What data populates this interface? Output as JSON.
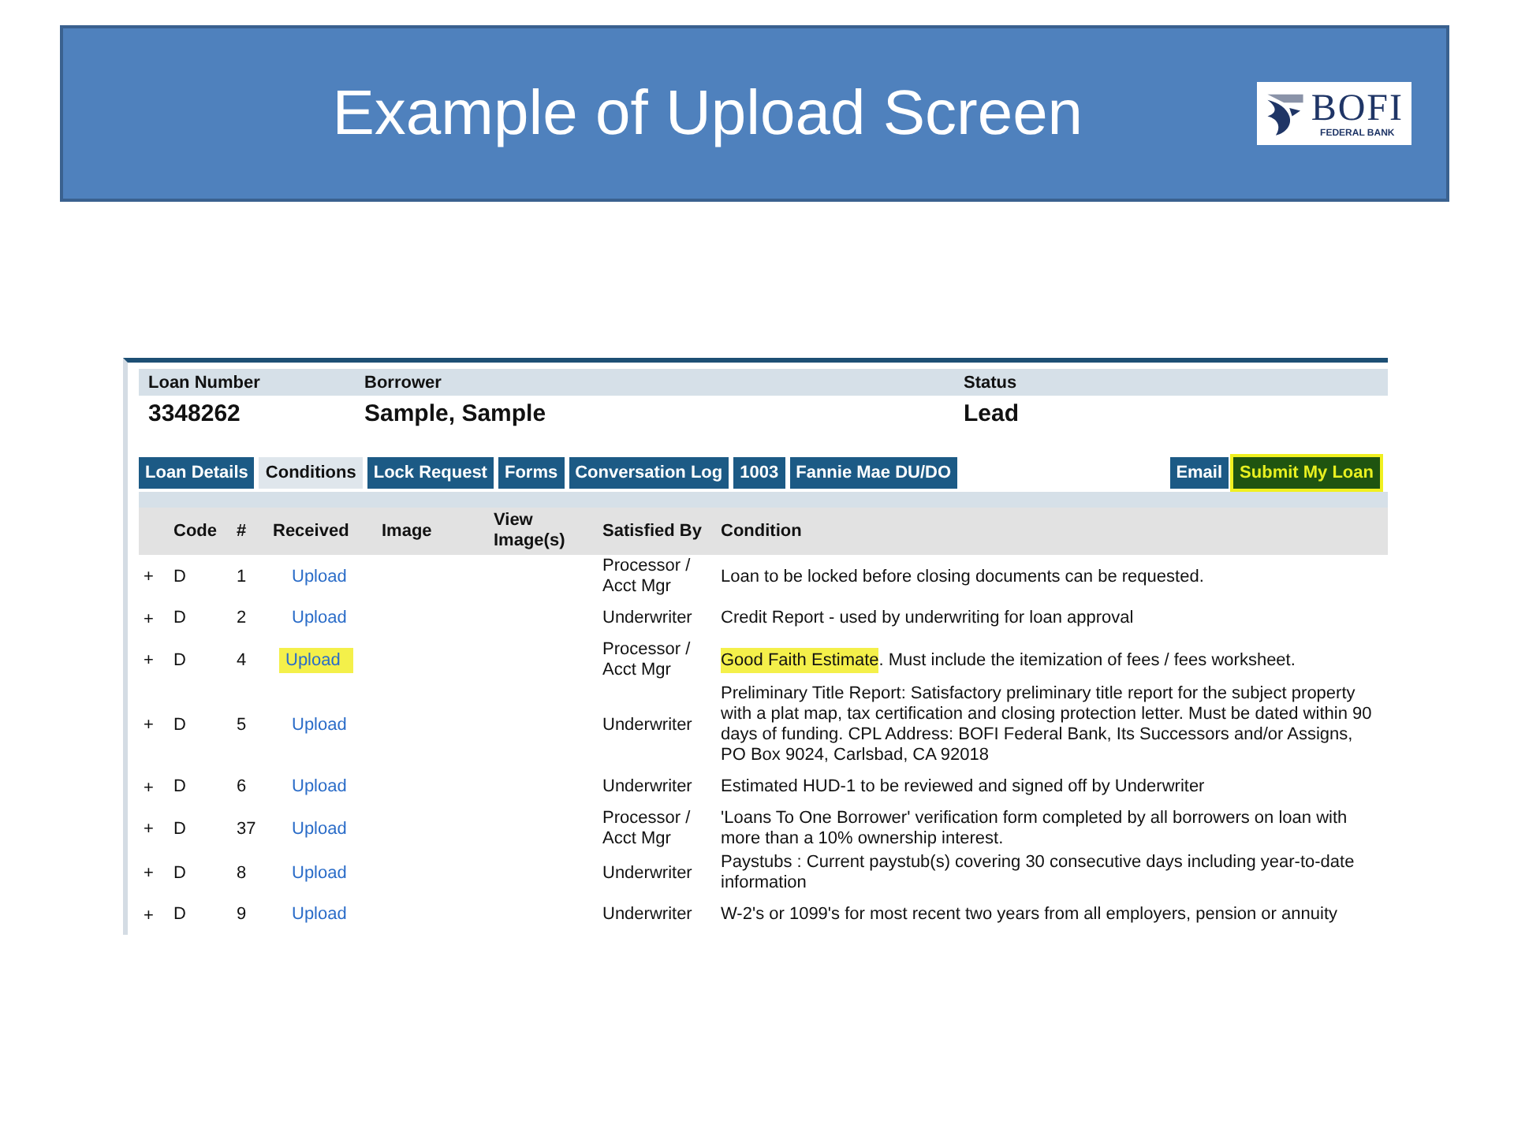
{
  "slide": {
    "title": "Example of Upload Screen",
    "logo": {
      "name": "BOFI",
      "subtitle": "FEDERAL BANK"
    }
  },
  "loan": {
    "headers": [
      "Loan Number",
      "Borrower",
      "Status"
    ],
    "values": [
      "3348262",
      "Sample, Sample",
      "Lead"
    ]
  },
  "tabs": [
    {
      "label": "Loan Details",
      "selected": false
    },
    {
      "label": "Conditions",
      "selected": true
    },
    {
      "label": "Lock Request",
      "selected": false
    },
    {
      "label": "Forms",
      "selected": false
    },
    {
      "label": "Conversation Log",
      "selected": false
    },
    {
      "label": "1003",
      "selected": false
    },
    {
      "label": "Fannie Mae DU/DO",
      "selected": false
    }
  ],
  "actions": [
    {
      "label": "Email",
      "highlighted": false
    },
    {
      "label": "Submit My Loan",
      "highlighted": true
    }
  ],
  "table": {
    "columns": [
      "Code",
      "#",
      "Received",
      "Image",
      "View Image(s)",
      "Satisfied By",
      "Condition"
    ],
    "rows": [
      {
        "expander": "+",
        "code": "D",
        "number": "1",
        "received": "Upload",
        "upload_highlighted": false,
        "satisfied_by": "Processor / Acct Mgr",
        "condition": "Loan to be locked before closing documents can be requested."
      },
      {
        "expander": "+",
        "code": "D",
        "number": "2",
        "received": "Upload",
        "upload_highlighted": false,
        "satisfied_by": "Underwriter",
        "condition": "Credit Report - used by underwriting for loan approval"
      },
      {
        "expander": "+",
        "code": "D",
        "number": "4",
        "received": "Upload",
        "upload_highlighted": true,
        "satisfied_by": "Processor / Acct Mgr",
        "condition_highlight": "Good Faith Estimate",
        "condition": ". Must include the itemization of fees / fees worksheet."
      },
      {
        "expander": "+",
        "code": "D",
        "number": "5",
        "received": "Upload",
        "upload_highlighted": false,
        "satisfied_by": "Underwriter",
        "condition": "Preliminary Title Report: Satisfactory preliminary title report for the subject property with a plat map, tax certification and closing protection letter. Must be dated within 90 days of funding. CPL Address: BOFI Federal Bank, Its Successors and/or Assigns, PO Box 9024, Carlsbad, CA 92018"
      },
      {
        "expander": "+",
        "code": "D",
        "number": "6",
        "received": "Upload",
        "upload_highlighted": false,
        "satisfied_by": "Underwriter",
        "condition": "Estimated HUD-1 to be reviewed and signed off by Underwriter"
      },
      {
        "expander": "+",
        "code": "D",
        "number": "37",
        "received": "Upload",
        "upload_highlighted": false,
        "satisfied_by": "Processor / Acct Mgr",
        "condition": "'Loans To One Borrower' verification form completed by all borrowers on loan with more than a 10% ownership interest."
      },
      {
        "expander": "+",
        "code": "D",
        "number": "8",
        "received": "Upload",
        "upload_highlighted": false,
        "satisfied_by": "Underwriter",
        "condition": "Paystubs : Current paystub(s) covering 30 consecutive days including year-to-date information"
      },
      {
        "expander": "+",
        "code": "D",
        "number": "9",
        "received": "Upload",
        "upload_highlighted": false,
        "satisfied_by": "Underwriter",
        "condition": "W-2's or 1099's for most recent two years from all employers, pension or annuity"
      }
    ]
  }
}
